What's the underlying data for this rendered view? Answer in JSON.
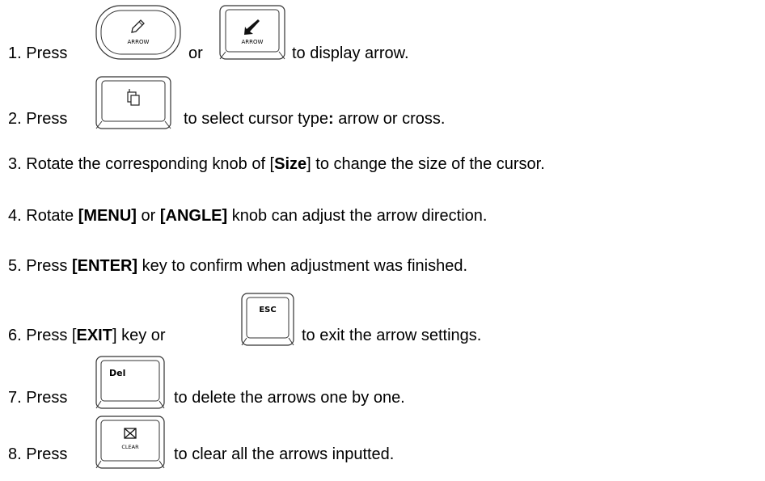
{
  "steps": [
    {
      "num": "1.",
      "parts": [
        "Press",
        "or",
        "to display arrow."
      ]
    },
    {
      "num": "2.",
      "parts": [
        "Press",
        "to select cursor type",
        ":",
        " arrow or cross."
      ]
    },
    {
      "num": "3.",
      "parts": [
        "Rotate the corresponding knob of [",
        "Size",
        "] to change the size of the cursor."
      ]
    },
    {
      "num": "4.",
      "parts": [
        "Rotate ",
        "[MENU]",
        " or ",
        "[ANGLE]",
        " knob can adjust the arrow direction."
      ]
    },
    {
      "num": "5.",
      "parts": [
        "Press ",
        "[ENTER]",
        " key to confirm when adjustment was finished."
      ]
    },
    {
      "num": "6.",
      "parts": [
        "Press [",
        "EXIT",
        "] key or",
        "to exit the arrow settings."
      ]
    },
    {
      "num": "7.",
      "parts": [
        "Press",
        "to delete the arrows one by one."
      ]
    },
    {
      "num": "8.",
      "parts": [
        "Press",
        "to clear all the arrows inputted."
      ]
    }
  ],
  "keys": {
    "arrow_rounded": {
      "label": "ARROW",
      "icon": "pencil-icon"
    },
    "arrow_square": {
      "label": "ARROW",
      "icon": "arrow-down-left-icon"
    },
    "cursor_type": {
      "label": "",
      "icon": "cursor-type-icon"
    },
    "esc": {
      "label": "ESC"
    },
    "del": {
      "label": "Del"
    },
    "clear": {
      "label": "CLEAR",
      "icon": "clear-box-icon"
    }
  }
}
